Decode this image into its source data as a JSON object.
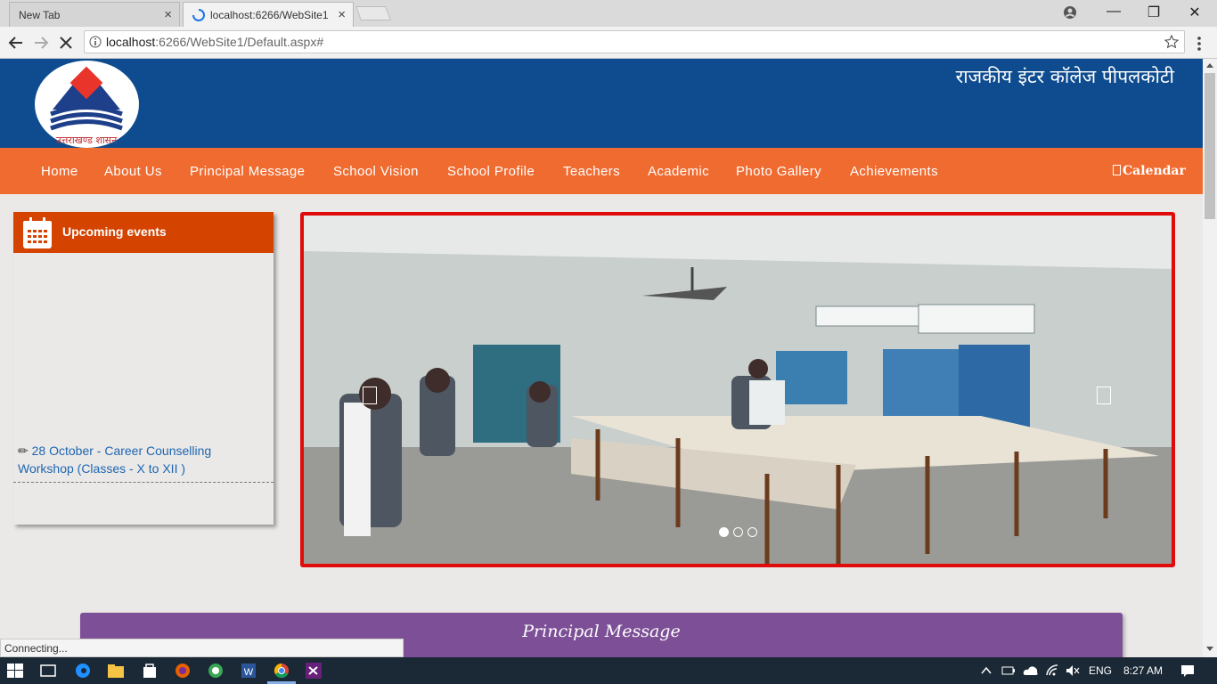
{
  "browser": {
    "tabs": [
      {
        "title": "New Tab"
      },
      {
        "title": "localhost:6266/WebSite1"
      }
    ],
    "close_symbol": "×",
    "window_controls": {
      "minimize": "—",
      "maximize": "❐",
      "close": "✕"
    },
    "url": {
      "host": "localhost",
      "path": ":6266/WebSite1/Default.aspx#"
    },
    "status": "Connecting..."
  },
  "site": {
    "logo_caption": "उत्तराखण्ड शासन",
    "school_name": "राजकीय इंटर कॉलेज पीपलकोटी",
    "menu": [
      "Home",
      "About Us",
      "Principal Message",
      "School Vision",
      "School Profile",
      "Teachers",
      "Academic",
      "Photo Gallery",
      "Achievements"
    ],
    "calendar": "Calendar",
    "events": {
      "title": "Upcoming events",
      "items": [
        {
          "text": "28 October - Career Counselling Workshop (Classes - X to XII )"
        }
      ]
    },
    "slider": {
      "slides": 3,
      "active": 1
    },
    "principal_message_title": "Principal Message"
  },
  "taskbar": {
    "language": "ENG",
    "time": "8:27 AM"
  },
  "colors": {
    "banner": "#0e4c8f",
    "menu": "#f06b30",
    "events_header": "#d44300",
    "slider_border": "#e00b0b",
    "principal_bar": "#7c4f96"
  }
}
